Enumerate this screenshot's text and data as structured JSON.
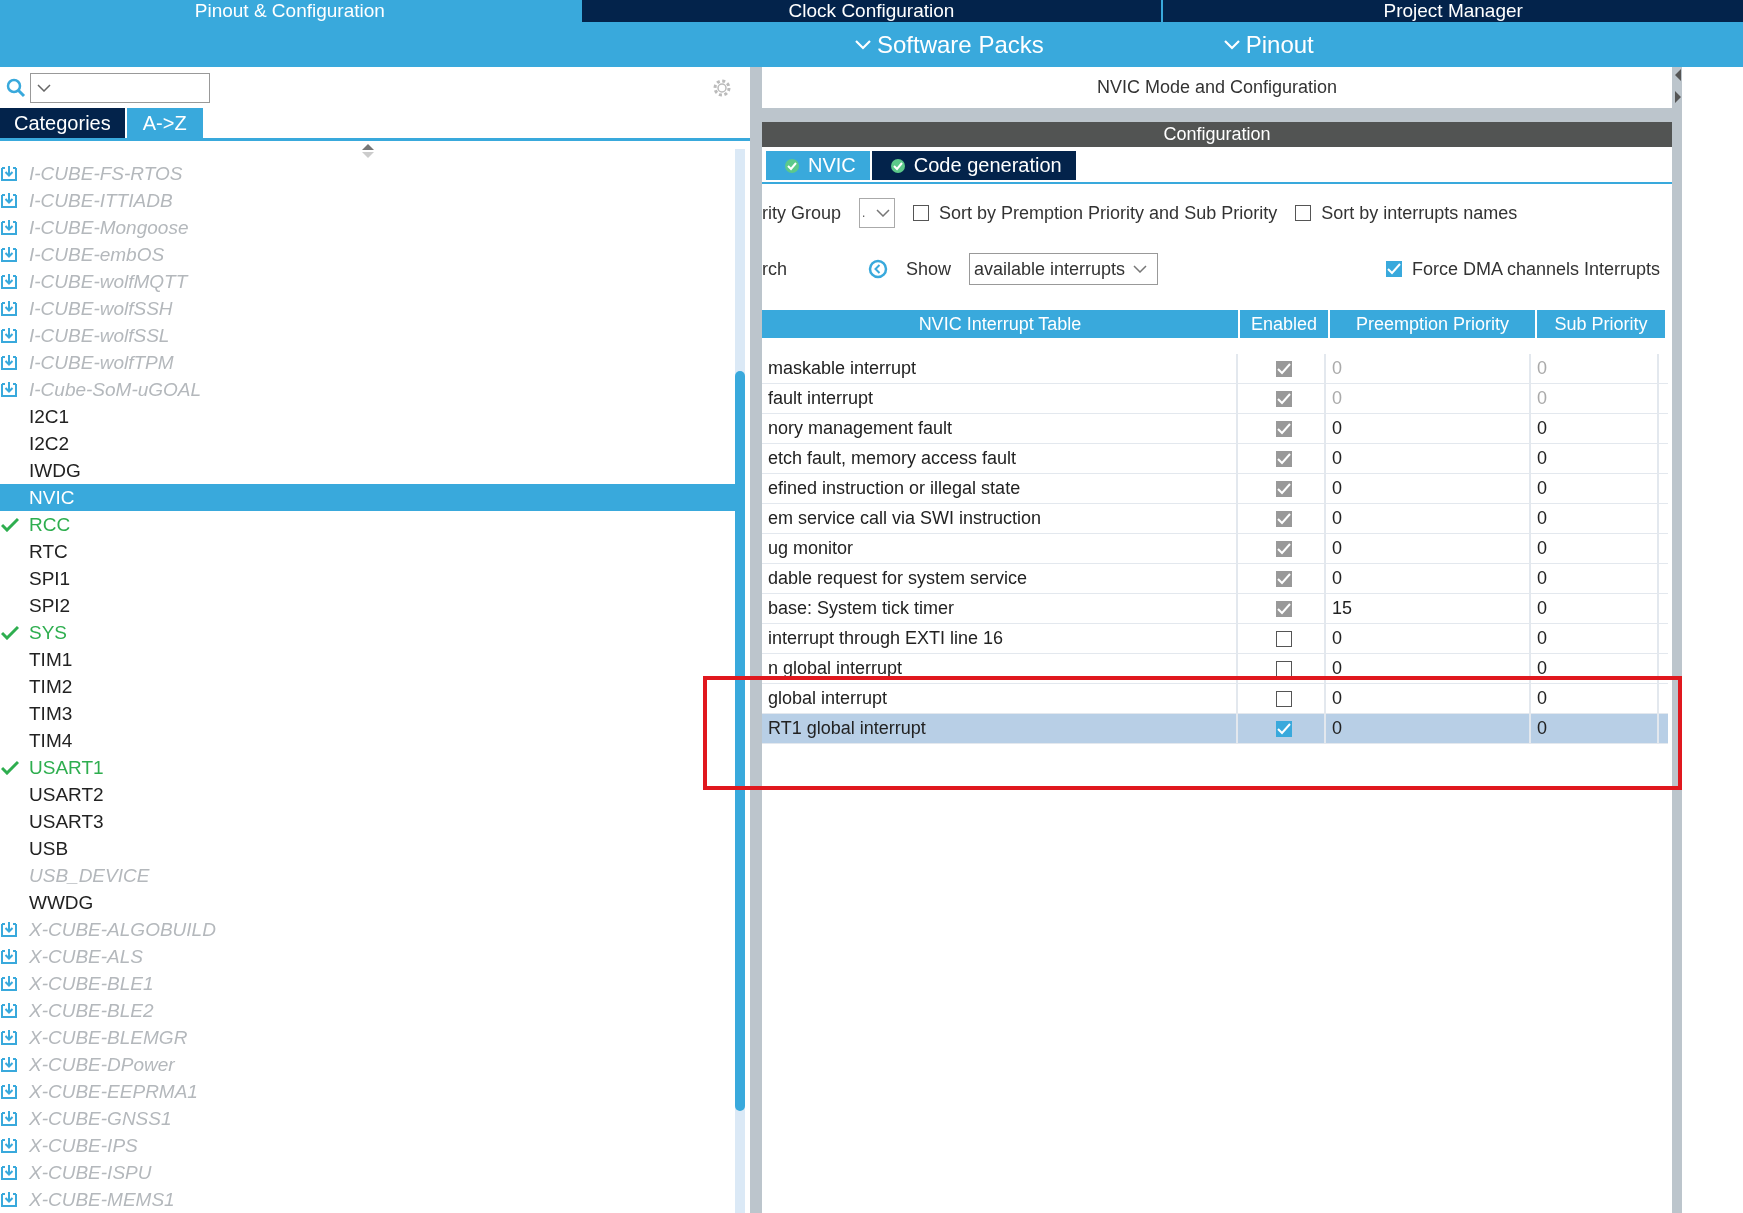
{
  "top_tabs": [
    {
      "label": "Pinout & Configuration",
      "selected": true
    },
    {
      "label": "Clock Configuration",
      "selected": false
    },
    {
      "label": "Project Manager",
      "selected": false
    }
  ],
  "menu": [
    {
      "label": "Software Packs"
    },
    {
      "label": "Pinout"
    }
  ],
  "sidebar": {
    "view_tabs": [
      {
        "label": "Categories",
        "selected": false
      },
      {
        "label": "A->Z",
        "selected": true
      }
    ],
    "items": [
      {
        "label": "I-CUBE-FS-RTOS",
        "kind": "package",
        "selected": false
      },
      {
        "label": "I-CUBE-ITTIADB",
        "kind": "package",
        "selected": false
      },
      {
        "label": "I-CUBE-Mongoose",
        "kind": "package",
        "selected": false
      },
      {
        "label": "I-CUBE-embOS",
        "kind": "package",
        "selected": false
      },
      {
        "label": "I-CUBE-wolfMQTT",
        "kind": "package",
        "selected": false
      },
      {
        "label": "I-CUBE-wolfSSH",
        "kind": "package",
        "selected": false
      },
      {
        "label": "I-CUBE-wolfSSL",
        "kind": "package",
        "selected": false
      },
      {
        "label": "I-CUBE-wolfTPM",
        "kind": "package",
        "selected": false
      },
      {
        "label": "I-Cube-SoM-uGOAL",
        "kind": "package",
        "selected": false
      },
      {
        "label": "I2C1",
        "kind": "peripheral",
        "selected": false
      },
      {
        "label": "I2C2",
        "kind": "peripheral",
        "selected": false
      },
      {
        "label": "IWDG",
        "kind": "peripheral",
        "selected": false
      },
      {
        "label": "NVIC",
        "kind": "peripheral",
        "selected": true
      },
      {
        "label": "RCC",
        "kind": "configured",
        "selected": false
      },
      {
        "label": "RTC",
        "kind": "peripheral",
        "selected": false
      },
      {
        "label": "SPI1",
        "kind": "peripheral",
        "selected": false
      },
      {
        "label": "SPI2",
        "kind": "peripheral",
        "selected": false
      },
      {
        "label": "SYS",
        "kind": "configured",
        "selected": false
      },
      {
        "label": "TIM1",
        "kind": "peripheral",
        "selected": false
      },
      {
        "label": "TIM2",
        "kind": "peripheral",
        "selected": false
      },
      {
        "label": "TIM3",
        "kind": "peripheral",
        "selected": false
      },
      {
        "label": "TIM4",
        "kind": "peripheral",
        "selected": false
      },
      {
        "label": "USART1",
        "kind": "configured",
        "selected": false
      },
      {
        "label": "USART2",
        "kind": "peripheral",
        "selected": false
      },
      {
        "label": "USART3",
        "kind": "peripheral",
        "selected": false
      },
      {
        "label": "USB",
        "kind": "peripheral",
        "selected": false
      },
      {
        "label": "USB_DEVICE",
        "kind": "unavailable",
        "selected": false
      },
      {
        "label": "WWDG",
        "kind": "peripheral",
        "selected": false
      },
      {
        "label": "X-CUBE-ALGOBUILD",
        "kind": "package",
        "selected": false
      },
      {
        "label": "X-CUBE-ALS",
        "kind": "package",
        "selected": false
      },
      {
        "label": "X-CUBE-BLE1",
        "kind": "package",
        "selected": false
      },
      {
        "label": "X-CUBE-BLE2",
        "kind": "package",
        "selected": false
      },
      {
        "label": "X-CUBE-BLEMGR",
        "kind": "package",
        "selected": false
      },
      {
        "label": "X-CUBE-DPower",
        "kind": "package",
        "selected": false
      },
      {
        "label": "X-CUBE-EEPRMA1",
        "kind": "package",
        "selected": false
      },
      {
        "label": "X-CUBE-GNSS1",
        "kind": "package",
        "selected": false
      },
      {
        "label": "X-CUBE-IPS",
        "kind": "package",
        "selected": false
      },
      {
        "label": "X-CUBE-ISPU",
        "kind": "package",
        "selected": false
      },
      {
        "label": "X-CUBE-MEMS1",
        "kind": "package",
        "selected": false
      }
    ]
  },
  "panel": {
    "title": "NVIC Mode and Configuration",
    "section": "Configuration",
    "tabs": [
      {
        "label": "NVIC",
        "selected": true
      },
      {
        "label": "Code generation",
        "selected": false
      }
    ],
    "priority_group": {
      "label": "rity Group",
      "value": "."
    },
    "options": [
      {
        "label": "Sort by Premption Priority and Sub Priority",
        "checked": false
      },
      {
        "label": "Sort by interrupts names",
        "checked": false
      }
    ],
    "search_label": "rch",
    "show": {
      "label": "Show",
      "value": "available interrupts"
    },
    "force_dma": {
      "label": "Force DMA channels Interrupts",
      "checked": true
    },
    "table": {
      "columns": [
        "NVIC Interrupt Table",
        "Enabled",
        "Preemption Priority",
        "Sub Priority"
      ],
      "rows": [
        {
          "name": "maskable interrupt",
          "enabled": true,
          "locked": true,
          "priority_locked": true,
          "preemption": "0",
          "sub": "0",
          "selected": false
        },
        {
          "name": "fault interrupt",
          "enabled": true,
          "locked": true,
          "priority_locked": true,
          "preemption": "0",
          "sub": "0",
          "selected": false
        },
        {
          "name": "nory management fault",
          "enabled": true,
          "locked": true,
          "priority_locked": false,
          "preemption": "0",
          "sub": "0",
          "selected": false
        },
        {
          "name": "etch fault, memory access fault",
          "enabled": true,
          "locked": true,
          "priority_locked": false,
          "preemption": "0",
          "sub": "0",
          "selected": false
        },
        {
          "name": "efined instruction or illegal state",
          "enabled": true,
          "locked": true,
          "priority_locked": false,
          "preemption": "0",
          "sub": "0",
          "selected": false
        },
        {
          "name": "em service call via SWI instruction",
          "enabled": true,
          "locked": true,
          "priority_locked": false,
          "preemption": "0",
          "sub": "0",
          "selected": false
        },
        {
          "name": "ug monitor",
          "enabled": true,
          "locked": true,
          "priority_locked": false,
          "preemption": "0",
          "sub": "0",
          "selected": false
        },
        {
          "name": "dable request for system service",
          "enabled": true,
          "locked": true,
          "priority_locked": false,
          "preemption": "0",
          "sub": "0",
          "selected": false
        },
        {
          "name": "base: System tick timer",
          "enabled": true,
          "locked": true,
          "priority_locked": false,
          "preemption": "15",
          "sub": "0",
          "selected": false
        },
        {
          "name": "interrupt through EXTI line 16",
          "enabled": false,
          "locked": false,
          "priority_locked": false,
          "preemption": "0",
          "sub": "0",
          "selected": false
        },
        {
          "name": "n global interrupt",
          "enabled": false,
          "locked": false,
          "priority_locked": false,
          "preemption": "0",
          "sub": "0",
          "selected": false
        },
        {
          "name": "global interrupt",
          "enabled": false,
          "locked": false,
          "priority_locked": false,
          "preemption": "0",
          "sub": "0",
          "selected": false
        },
        {
          "name": "RT1 global interrupt",
          "enabled": true,
          "locked": false,
          "priority_locked": false,
          "preemption": "0",
          "sub": "0",
          "selected": true
        }
      ]
    }
  }
}
